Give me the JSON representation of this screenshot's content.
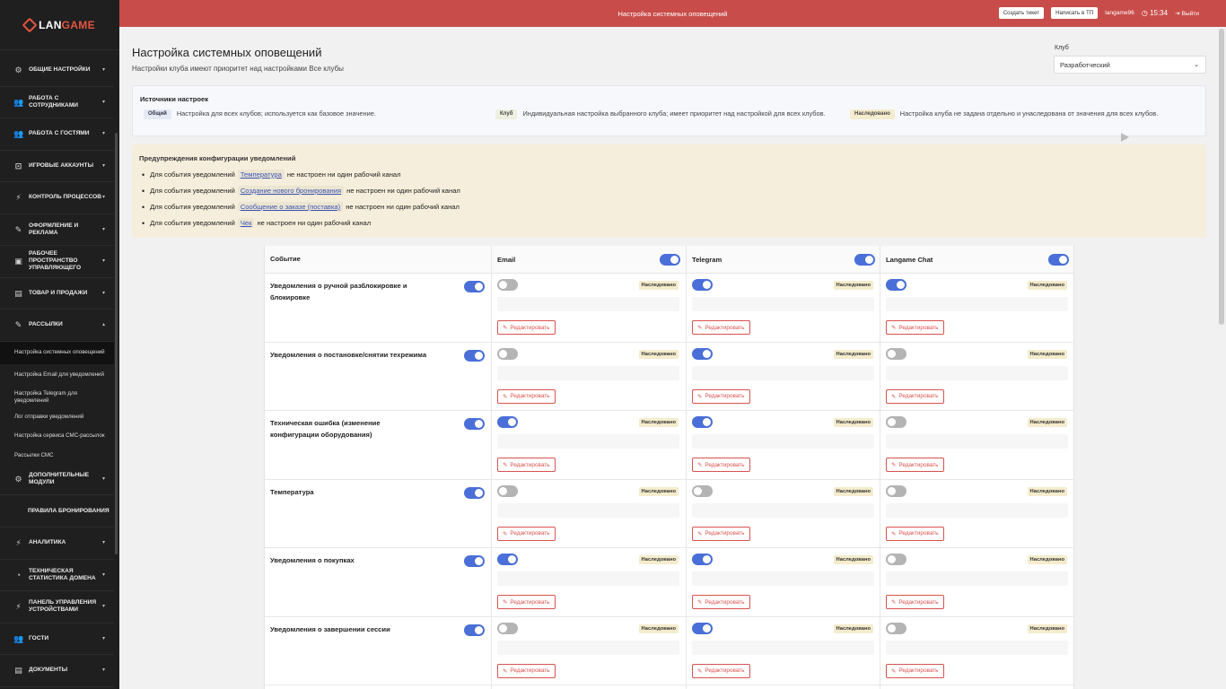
{
  "brand": {
    "text_a": "LAN",
    "text_b": "GAME"
  },
  "sidebar": {
    "items": [
      {
        "label": "Общие настройки",
        "icon": "gear-icon"
      },
      {
        "label": "Работа с сотрудниками",
        "icon": "users-icon"
      },
      {
        "label": "Работа с гостями",
        "icon": "guests-icon"
      },
      {
        "label": "Игровые аккаунты",
        "icon": "account-icon"
      },
      {
        "label": "Контроль процессов",
        "icon": "lightning-icon"
      },
      {
        "label": "Оформление и реклама",
        "icon": "edit-icon"
      },
      {
        "label": "Рабочее пространство управляющего",
        "icon": "briefcase-icon"
      },
      {
        "label": "Товар и продажи",
        "icon": "box-icon"
      },
      {
        "label": "Рассылки",
        "icon": "edit-icon"
      }
    ],
    "sub_items": [
      "Настройка системных оповещений",
      "Настройка Email для уведомлений",
      "Настройка Telegram для уведомлений",
      "Лог отправки уведомлений",
      "Настройка сервиса СМС-рассылок",
      "Рассылки СМС"
    ],
    "items_after": [
      {
        "label": "Дополнительные модули",
        "icon": "gear-icon"
      },
      {
        "label": "Правила бронирования",
        "icon": ""
      },
      {
        "label": "Аналитика",
        "icon": "lightning-icon"
      },
      {
        "label": "Техническая статистика домена",
        "icon": "pie-icon"
      },
      {
        "label": "Панель управления устройствами",
        "icon": "lightning-icon"
      },
      {
        "label": "Гости",
        "icon": "users-icon"
      },
      {
        "label": "Документы",
        "icon": "document-icon"
      }
    ]
  },
  "topbar": {
    "title": "Настройка системных оповещений",
    "create_ticket": "Создать тикет",
    "write_support": "Написать в ТП",
    "username": "langame96",
    "time": "15:34",
    "logout": "Выйти"
  },
  "page": {
    "title": "Настройка системных оповещений",
    "subtitle": "Настройки клуба имеют приоритет над настройками Все клубы",
    "club_label": "Клуб",
    "club_value": "Разработческий"
  },
  "sources": {
    "title": "Источники настроек",
    "common_badge": "Общий",
    "common_text": "Настройка для всех клубов; используется как базовое значение.",
    "club_badge": "Клуб",
    "club_text": "Индивидуальная настройка выбранного клуба; имеет приоритет над настройкой для всех клубов.",
    "inherited_badge": "Наследовано",
    "inherited_text": "Настройка клуба не задана отдельно и унаследована от значения для всех клубов."
  },
  "warnings": {
    "title": "Предупреждения конфигурации уведомлений",
    "prefix": "Для события уведомлений",
    "suffix": "не настроен ни один рабочий канал",
    "events": [
      "Температура",
      "Создание нового бронирования",
      "Сообщение о заказе (поставка)",
      "Чек"
    ]
  },
  "table": {
    "headers": {
      "event": "Событие",
      "email": "Email",
      "telegram": "Telegram",
      "chat": "Langame Chat"
    },
    "inherited": "Наследовано",
    "edit": "Редактировать",
    "rows": [
      {
        "event": "Уведомления о ручной разблокировке и блокировке",
        "enabled": true,
        "email": false,
        "telegram": true,
        "chat": true
      },
      {
        "event": "Уведомления о постановке/снятии техрежима",
        "enabled": true,
        "email": false,
        "telegram": true,
        "chat": false
      },
      {
        "event": "Техническая ошибка (изменение конфигурации оборудования)",
        "enabled": true,
        "email": true,
        "telegram": true,
        "chat": false
      },
      {
        "event": "Температура",
        "enabled": true,
        "email": false,
        "telegram": false,
        "chat": false
      },
      {
        "event": "Уведомления о покупках",
        "enabled": true,
        "email": true,
        "telegram": true,
        "chat": false
      },
      {
        "event": "Уведомления о завершении сессии",
        "enabled": true,
        "email": false,
        "telegram": true,
        "chat": false
      }
    ]
  },
  "colors": {
    "accent": "#c84d4a",
    "toggle_on": "#4a6fd8",
    "sidebar": "#1f1f1f"
  }
}
